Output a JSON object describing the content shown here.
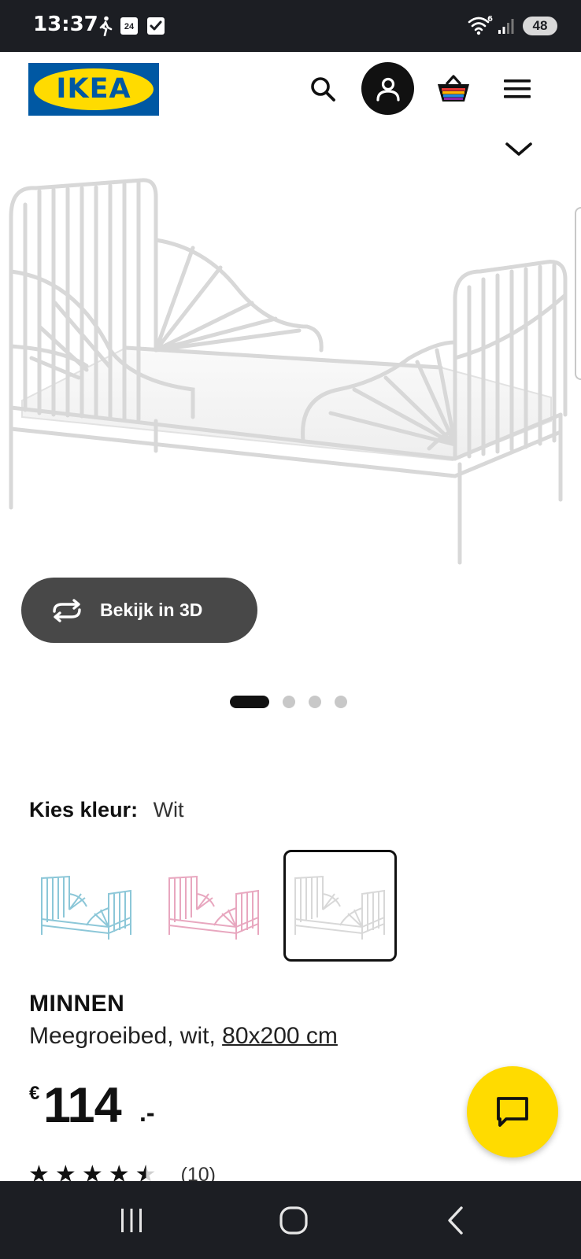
{
  "status_bar": {
    "time": "13:37",
    "calendar_date": "24",
    "network_badge": "6",
    "battery": "48"
  },
  "header": {
    "logo_text": "IKEA",
    "logo_mark": "®"
  },
  "gallery": {
    "view3d_label": "Bekijk in 3D",
    "dot_count": 4,
    "active_dot": 1
  },
  "color_picker": {
    "label": "Kies kleur:",
    "value": "Wit",
    "options": [
      {
        "name": "Blauw",
        "color": "#8cc7d8"
      },
      {
        "name": "Roze",
        "color": "#e8a7bf"
      },
      {
        "name": "Wit",
        "color": "#e4e4e4",
        "selected": true
      }
    ]
  },
  "product": {
    "name": "MINNEN",
    "description": "Meegroeibed, wit, ",
    "size": "80x200 cm",
    "price_currency": "€",
    "price_value": "114",
    "price_suffix": ".-",
    "rating": 4.5,
    "review_count": "(10)"
  },
  "colors": {
    "brand_blue": "#0058a3",
    "brand_yellow": "#ffdb00",
    "dark": "#111111",
    "system_bar": "#1c1e23"
  }
}
